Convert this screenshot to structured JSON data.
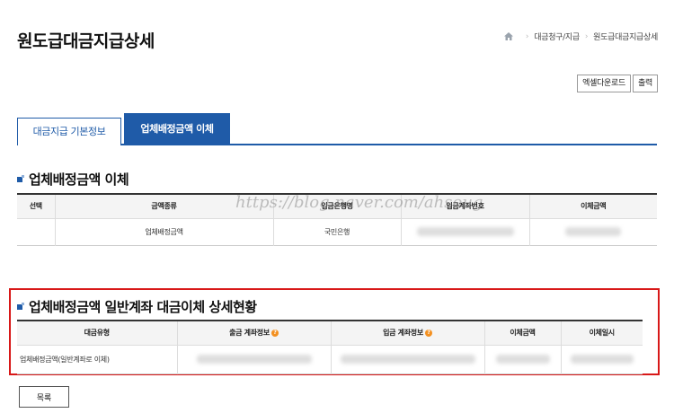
{
  "page_title": "원도급대금지급상세",
  "breadcrumb": [
    "대금청구/지급",
    "원도급대금지급상세"
  ],
  "toolbar": {
    "excel_label": "엑셀다운로드",
    "print_label": "출력"
  },
  "tabs": [
    {
      "label": "대금지급 기본정보",
      "active": false
    },
    {
      "label": "업체배정금액 이체",
      "active": true
    }
  ],
  "section1": {
    "title": "업체배정금액 이체",
    "headers": [
      "선택",
      "금액종류",
      "입금은행명",
      "입금계좌번호",
      "이체금액"
    ],
    "row": {
      "select": "",
      "amount_type": "업체배정금액",
      "bank": "국민은행"
    }
  },
  "section2": {
    "title": "업체배정금액 일반계좌 대금이체 상세현황",
    "headers": [
      "대금유형",
      "출금 계좌정보",
      "입금 계좌정보",
      "이체금액",
      "이체일시"
    ],
    "row": {
      "type": "업체배정금액(일반계좌로 이체)"
    }
  },
  "watermark": "https://blog.naver.com/ahsoug",
  "list_button_label": "목록",
  "colors": {
    "accent": "#1f5ba8",
    "highlight_box": "#d81818",
    "info_icon": "#f39020"
  }
}
